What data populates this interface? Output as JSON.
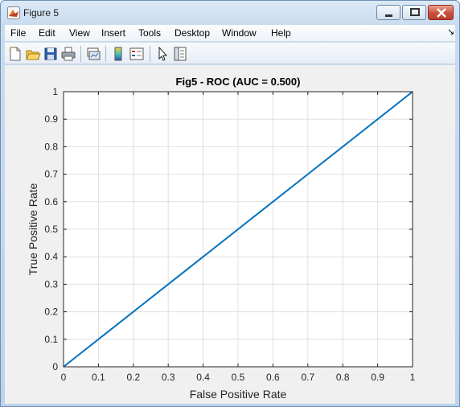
{
  "window": {
    "title": "Figure 5"
  },
  "menu": [
    "File",
    "Edit",
    "View",
    "Insert",
    "Tools",
    "Desktop",
    "Window",
    "Help"
  ],
  "toolbar_icons": [
    "new-figure-icon",
    "open-file-icon",
    "save-icon",
    "print-icon",
    "link-plot-icon",
    "colorbar-icon",
    "legend-icon",
    "pointer-icon",
    "property-editor-icon"
  ],
  "colors": {
    "line": "#0072bd",
    "background": "#f0f0f0",
    "grid": "#e0e0e0"
  },
  "chart_data": {
    "type": "line",
    "title": "Fig5 - ROC (AUC = 0.500)",
    "xlabel": "False Positive Rate",
    "ylabel": "True Positive Rate",
    "xlim": [
      0,
      1
    ],
    "ylim": [
      0,
      1
    ],
    "xticks": [
      "0",
      "0.1",
      "0.2",
      "0.3",
      "0.4",
      "0.5",
      "0.6",
      "0.7",
      "0.8",
      "0.9",
      "1"
    ],
    "yticks": [
      "0",
      "0.1",
      "0.2",
      "0.3",
      "0.4",
      "0.5",
      "0.6",
      "0.7",
      "0.8",
      "0.9",
      "1"
    ],
    "grid": true,
    "series": [
      {
        "x": [
          0,
          1
        ],
        "y": [
          0,
          1
        ]
      }
    ]
  }
}
